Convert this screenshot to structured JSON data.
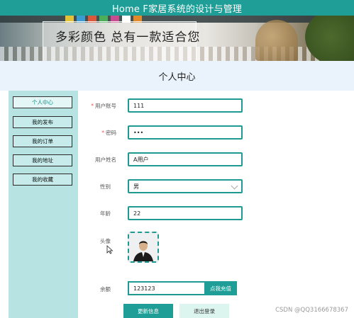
{
  "app": {
    "title": "Home F家居系统的设计与管理"
  },
  "banner": {
    "tagline": "多彩颜色  总有一款适合您"
  },
  "page": {
    "title": "个人中心"
  },
  "sidebar": {
    "items": [
      {
        "label": "个人中心",
        "active": true
      },
      {
        "label": "我的发布",
        "active": false
      },
      {
        "label": "我的订单",
        "active": false
      },
      {
        "label": "我的地址",
        "active": false
      },
      {
        "label": "我的收藏",
        "active": false
      }
    ]
  },
  "form": {
    "account": {
      "label": "用户账号",
      "required": "*",
      "value": "111"
    },
    "password": {
      "label": "密码",
      "required": "*",
      "value": "•••"
    },
    "name": {
      "label": "用户姓名",
      "value": "A用户"
    },
    "gender": {
      "label": "性别",
      "value": "男"
    },
    "age": {
      "label": "年龄",
      "value": "22"
    },
    "avatar": {
      "label": "头像"
    },
    "balance": {
      "label": "余额",
      "value": "123123",
      "recharge_label": "点我充值"
    }
  },
  "actions": {
    "update_label": "更新信息",
    "logout_label": "退出登录"
  },
  "watermark": {
    "text": "CSDN @QQ3166678367"
  },
  "colors": {
    "accent": "#1e9e96",
    "sidebar_bg": "#b8e3e3",
    "title_band": "#eaf3fb"
  }
}
